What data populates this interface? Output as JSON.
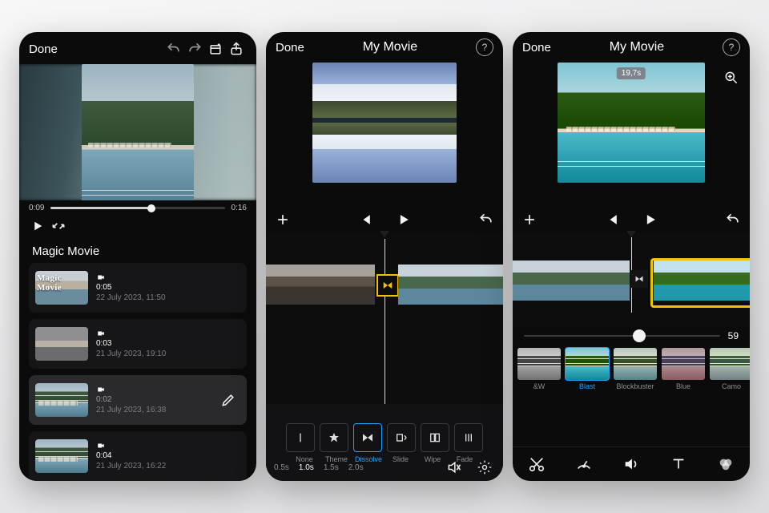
{
  "phone1": {
    "header": {
      "done": "Done"
    },
    "time": {
      "current": "0:09",
      "total": "0:16"
    },
    "section_title": "Magic Movie",
    "clips": [
      {
        "overlay": "Magic Movie",
        "duration": "0:05",
        "date": "22 July 2023, 11:50"
      },
      {
        "overlay": "",
        "duration": "0:03",
        "date": "21 July 2023, 19:10"
      },
      {
        "overlay": "",
        "duration": "0:02",
        "date": "21 July 2023, 16:38"
      },
      {
        "overlay": "",
        "duration": "0:04",
        "date": "21 July 2023, 16:22"
      }
    ]
  },
  "phone2": {
    "header": {
      "done": "Done",
      "title": "My Movie"
    },
    "transitions": {
      "options": [
        "None",
        "Theme",
        "Dissolve",
        "Slide",
        "Wipe",
        "Fade"
      ],
      "selected_index": 2,
      "durations": [
        "0.5s",
        "1.0s",
        "1.5s",
        "2.0s"
      ],
      "selected_duration_index": 1
    }
  },
  "phone3": {
    "header": {
      "done": "Done",
      "title": "My Movie"
    },
    "preview_badge": "19,7s",
    "slider_value": "59",
    "filters": {
      "items": [
        "&W",
        "Blast",
        "Blockbuster",
        "Blue",
        "Camo"
      ],
      "selected_index": 1
    }
  }
}
